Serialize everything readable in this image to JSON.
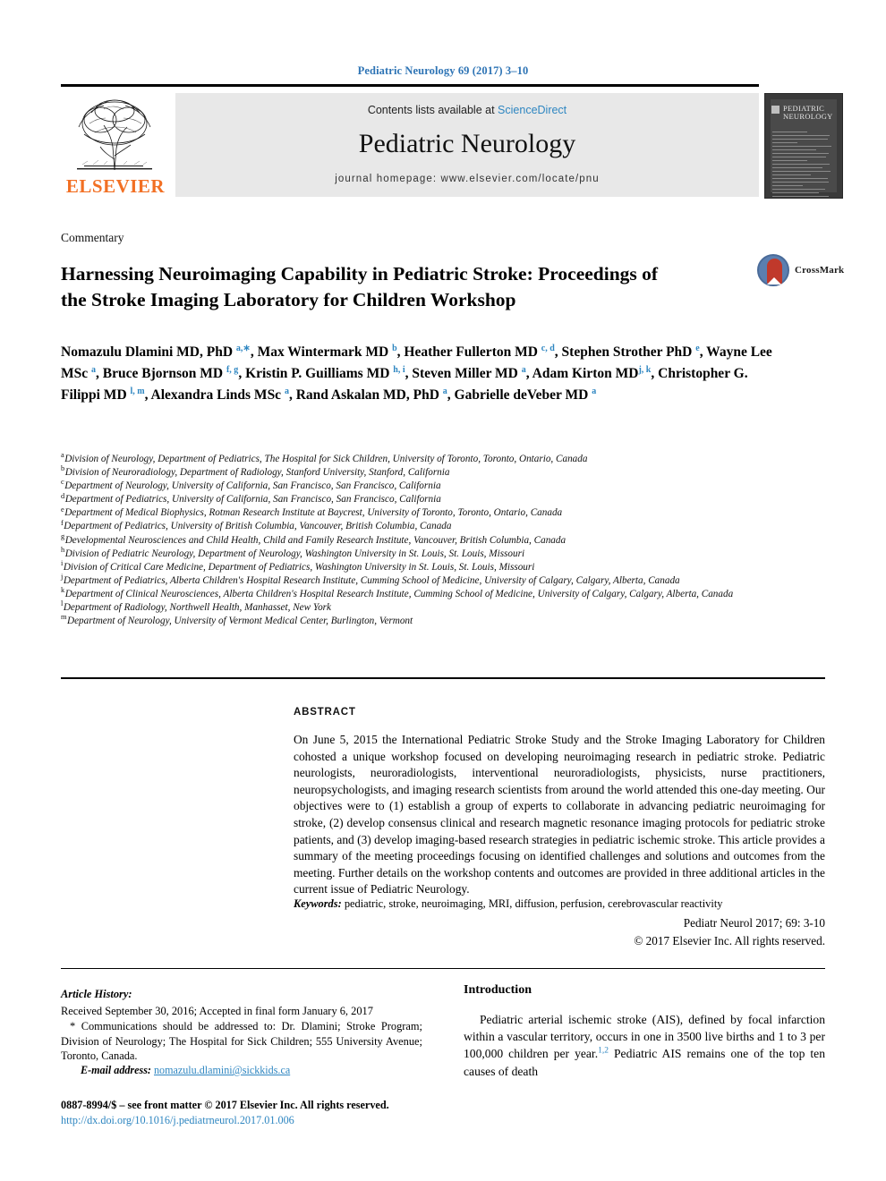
{
  "running_head": "Pediatric Neurology 69 (2017) 3–10",
  "masthead": {
    "contents_prefix": "Contents lists available at",
    "sciencedirect": "ScienceDirect",
    "journal_name": "Pediatric Neurology",
    "homepage": "journal homepage: www.elsevier.com/locate/pnu",
    "publisher": "ELSEVIER",
    "cover_title_line1": "PEDIATRIC",
    "cover_title_line2": "NEUROLOGY"
  },
  "article": {
    "doctype": "Commentary",
    "title": "Harnessing Neuroimaging Capability in Pediatric Stroke: Proceedings of the Stroke Imaging Laboratory for Children Workshop",
    "crossmark_label": "CrossMark"
  },
  "authors_html": "Nomazulu Dlamini MD, PhD <sup>a,∗</sup>, Max Wintermark MD <sup>b</sup>, Heather Fullerton MD <sup>c, d</sup>, Stephen Strother PhD <sup>e</sup>, Wayne Lee MSc <sup>a</sup>, Bruce Bjornson MD <sup>f, g</sup>, Kristin P. Guilliams MD <sup>h, i</sup>, Steven Miller MD <sup>a</sup>, Adam Kirton MD<sup>j, k</sup>, Christopher G. Filippi MD <sup>l, m</sup>, Alexandra Linds MSc <sup>a</sup>, Rand Askalan MD, PhD <sup>a</sup>, Gabrielle deVeber MD <sup>a</sup>",
  "affiliations": [
    {
      "label": "a",
      "text": "Division of Neurology, Department of Pediatrics, The Hospital for Sick Children, University of Toronto, Toronto, Ontario, Canada"
    },
    {
      "label": "b",
      "text": "Division of Neuroradiology, Department of Radiology, Stanford University, Stanford, California"
    },
    {
      "label": "c",
      "text": "Department of Neurology, University of California, San Francisco, San Francisco, California"
    },
    {
      "label": "d",
      "text": "Department of Pediatrics, University of California, San Francisco, San Francisco, California"
    },
    {
      "label": "e",
      "text": "Department of Medical Biophysics, Rotman Research Institute at Baycrest, University of Toronto, Toronto, Ontario, Canada"
    },
    {
      "label": "f",
      "text": "Department of Pediatrics, University of British Columbia, Vancouver, British Columbia, Canada"
    },
    {
      "label": "g",
      "text": "Developmental Neurosciences and Child Health, Child and Family Research Institute, Vancouver, British Columbia, Canada"
    },
    {
      "label": "h",
      "text": "Division of Pediatric Neurology, Department of Neurology, Washington University in St. Louis, St. Louis, Missouri"
    },
    {
      "label": "i",
      "text": "Division of Critical Care Medicine, Department of Pediatrics, Washington University in St. Louis, St. Louis, Missouri"
    },
    {
      "label": "j",
      "text": "Department of Pediatrics, Alberta Children's Hospital Research Institute, Cumming School of Medicine, University of Calgary, Calgary, Alberta, Canada"
    },
    {
      "label": "k",
      "text": "Department of Clinical Neurosciences, Alberta Children's Hospital Research Institute, Cumming School of Medicine, University of Calgary, Calgary, Alberta, Canada"
    },
    {
      "label": "l",
      "text": "Department of Radiology, Northwell Health, Manhasset, New York"
    },
    {
      "label": "m",
      "text": "Department of Neurology, University of Vermont Medical Center, Burlington, Vermont"
    }
  ],
  "abstract": {
    "label": "ABSTRACT",
    "body": "On June 5, 2015 the International Pediatric Stroke Study and the Stroke Imaging Laboratory for Children cohosted a unique workshop focused on developing neuroimaging research in pediatric stroke. Pediatric neurologists, neuroradiologists, interventional neuroradiologists, physicists, nurse practitioners, neuropsychologists, and imaging research scientists from around the world attended this one-day meeting. Our objectives were to (1) establish a group of experts to collaborate in advancing pediatric neuroimaging for stroke, (2) develop consensus clinical and research magnetic resonance imaging protocols for pediatric stroke patients, and (3) develop imaging-based research strategies in pediatric ischemic stroke. This article provides a summary of the meeting proceedings focusing on identified challenges and solutions and outcomes from the meeting. Further details on the workshop contents and outcomes are provided in three additional articles in the current issue of Pediatric Neurology.",
    "keywords_label": "Keywords:",
    "keywords": "pediatric, stroke, neuroimaging, MRI, diffusion, perfusion, cerebrovascular reactivity",
    "citation": "Pediatr Neurol 2017; 69: 3-10",
    "copyright": "© 2017 Elsevier Inc. All rights reserved."
  },
  "footer": {
    "history_title": "Article History:",
    "history_line": "Received September 30, 2016; Accepted in final form January 6, 2017",
    "correspondence": "* Communications should be addressed to: Dr. Dlamini; Stroke Program; Division of Neurology; The Hospital for Sick Children; 555 University Avenue; Toronto, Canada.",
    "email_label": "E-mail address:",
    "email": "nomazulu.dlamini@sickkids.ca",
    "issn": "0887-8994/$ – see front matter © 2017 Elsevier Inc. All rights reserved.",
    "doi": "http://dx.doi.org/10.1016/j.pediatrneurol.2017.01.006"
  },
  "introduction": {
    "heading": "Introduction",
    "paragraph_pre": "Pediatric arterial ischemic stroke (AIS), defined by focal infarction within a vascular territory, occurs in one in 3500 live births and 1 to 3 per 100,000 children per year.",
    "ref_marker": "1,2",
    "paragraph_post": " Pediatric AIS remains one of the top ten causes of death"
  },
  "colors": {
    "link": "#2e86c1",
    "runhead": "#2e74b5",
    "elsevier_orange": "#F27024",
    "band_gray": "#e8e8e8"
  }
}
